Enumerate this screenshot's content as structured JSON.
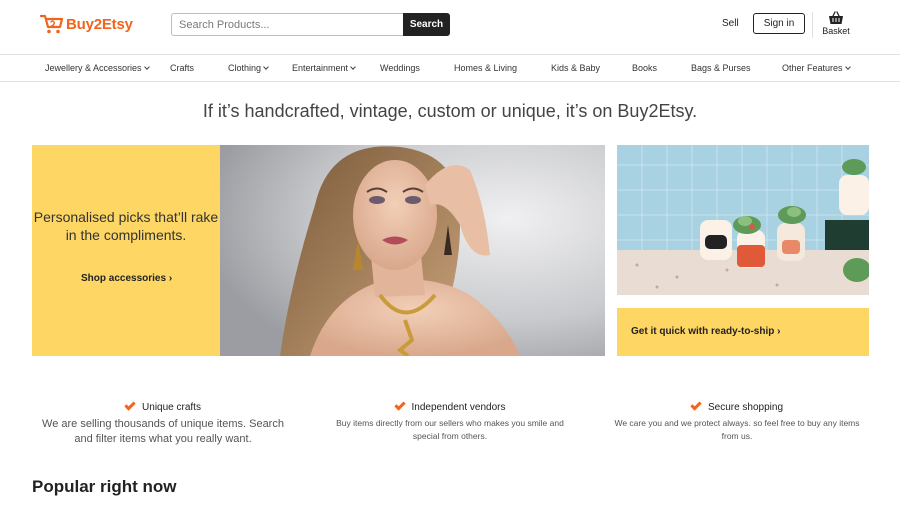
{
  "header": {
    "brand": "Buy2Etsy",
    "search_placeholder": "Search Products...",
    "search_button": "Search",
    "sell": "Sell",
    "sign_in": "Sign in",
    "basket": "Basket",
    "accent_color": "#f1641e"
  },
  "categories": [
    {
      "label": "Jewellery & Accessories",
      "has_dropdown": true
    },
    {
      "label": "Crafts",
      "has_dropdown": false
    },
    {
      "label": "Clothing",
      "has_dropdown": true
    },
    {
      "label": "Entertainment",
      "has_dropdown": true
    },
    {
      "label": "Weddings",
      "has_dropdown": false
    },
    {
      "label": "Homes & Living",
      "has_dropdown": false
    },
    {
      "label": "Kids & Baby",
      "has_dropdown": false
    },
    {
      "label": "Books",
      "has_dropdown": false
    },
    {
      "label": "Bags & Purses",
      "has_dropdown": false
    },
    {
      "label": "Other Features",
      "has_dropdown": true
    }
  ],
  "tagline": "If it’s handcrafted, vintage, custom or unique, it’s on Buy2Etsy.",
  "hero": {
    "promo_text": "Personalised picks that’ll rake in the compliments.",
    "promo_link": "Shop accessories ›",
    "ship_link": "Get it quick with ready-to-ship ›",
    "promo_color": "#fdd663"
  },
  "features": [
    {
      "title": "Unique crafts",
      "desc": "We are selling thousands of unique items. Search and filter items what you really want.",
      "icon": "check-icon"
    },
    {
      "title": "Independent vendors",
      "desc": "Buy items directly from our sellers who makes you smile and special from others.",
      "icon": "check-icon"
    },
    {
      "title": "Secure shopping",
      "desc": "We care you and we protect always. so feel free to buy any items from us.",
      "icon": "check-icon"
    }
  ],
  "popular_heading": "Popular right now"
}
